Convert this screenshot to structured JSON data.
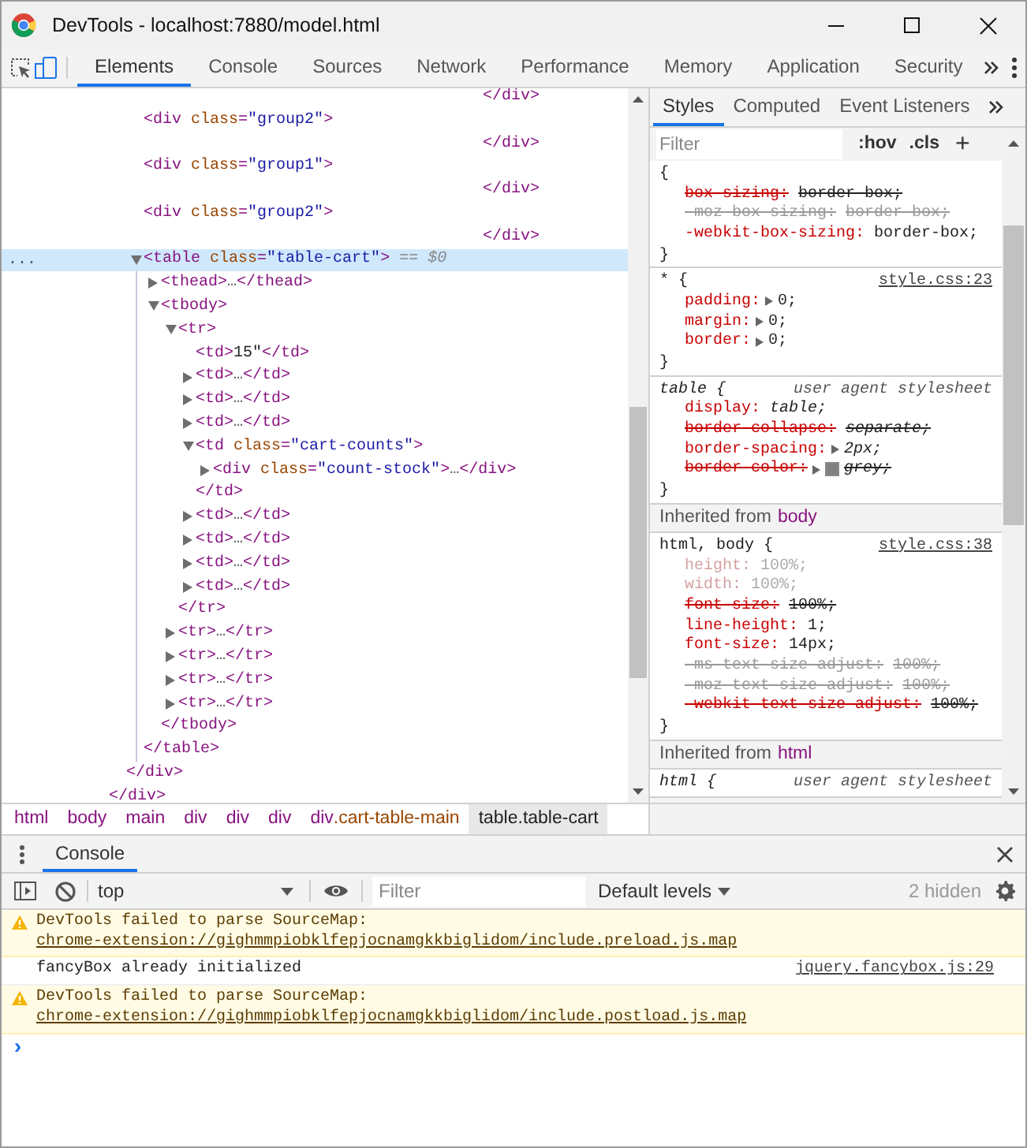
{
  "window": {
    "title": "DevTools - localhost:7880/model.html"
  },
  "tabs": [
    {
      "label": "Elements",
      "selected": true
    },
    {
      "label": "Console",
      "selected": false
    },
    {
      "label": "Sources",
      "selected": false
    },
    {
      "label": "Network",
      "selected": false
    },
    {
      "label": "Performance",
      "selected": false
    },
    {
      "label": "Memory",
      "selected": false
    },
    {
      "label": "Application",
      "selected": false
    },
    {
      "label": "Security",
      "selected": false
    }
  ],
  "elements": {
    "selection_marker": "...",
    "tree": [
      {
        "selected": false,
        "close": [
          {
            "kind": "tag",
            "text": "</div>"
          }
        ],
        "children": [
          {
            "selected": false,
            "close": [
              {
                "kind": "tag",
                "text": "</div>"
              }
            ],
            "children": [
              {
                "selected": false,
                "close_far": true,
                "close": [
                  {
                    "kind": "tag",
                    "text": "</div>"
                  }
                ]
              },
              {
                "selected": false,
                "open": [
                  {
                    "kind": "tag",
                    "text": "<div"
                  },
                  {
                    "kind": "attr",
                    "text": " class"
                  },
                  {
                    "kind": "tag",
                    "text": "="
                  },
                  {
                    "kind": "value",
                    "text": "\"group2\""
                  },
                  {
                    "kind": "tag",
                    "text": ">"
                  }
                ],
                "close_far": true,
                "close": [
                  {
                    "kind": "tag",
                    "text": "</div>"
                  }
                ]
              },
              {
                "selected": false,
                "open": [
                  {
                    "kind": "tag",
                    "text": "<div"
                  },
                  {
                    "kind": "attr",
                    "text": " class"
                  },
                  {
                    "kind": "tag",
                    "text": "="
                  },
                  {
                    "kind": "value",
                    "text": "\"group1\""
                  },
                  {
                    "kind": "tag",
                    "text": ">"
                  }
                ],
                "close_far": true,
                "close": [
                  {
                    "kind": "tag",
                    "text": "</div>"
                  }
                ]
              },
              {
                "selected": false,
                "open": [
                  {
                    "kind": "tag",
                    "text": "<div"
                  },
                  {
                    "kind": "attr",
                    "text": " class"
                  },
                  {
                    "kind": "tag",
                    "text": "="
                  },
                  {
                    "kind": "value",
                    "text": "\"group2\""
                  },
                  {
                    "kind": "tag",
                    "text": ">"
                  }
                ],
                "close_far": true,
                "close": [
                  {
                    "kind": "tag",
                    "text": "</div>"
                  }
                ]
              },
              {
                "selected": true,
                "expanded": true,
                "open": [
                  {
                    "kind": "tag",
                    "text": "<table"
                  },
                  {
                    "kind": "attr",
                    "text": " class"
                  },
                  {
                    "kind": "tag",
                    "text": "="
                  },
                  {
                    "kind": "value",
                    "text": "\"table-cart\""
                  },
                  {
                    "kind": "tag",
                    "text": ">"
                  },
                  {
                    "kind": "hint",
                    "text": " == $0"
                  }
                ],
                "close": [
                  {
                    "kind": "tag",
                    "text": "</table>"
                  }
                ],
                "children": [
                  {
                    "selected": false,
                    "expanded": false,
                    "open": [
                      {
                        "kind": "tag",
                        "text": "<thead>"
                      },
                      {
                        "kind": "ellipsis",
                        "text": "…"
                      },
                      {
                        "kind": "tag",
                        "text": "</thead>"
                      }
                    ]
                  },
                  {
                    "selected": false,
                    "expanded": true,
                    "open": [
                      {
                        "kind": "tag",
                        "text": "<tbody>"
                      }
                    ],
                    "close": [
                      {
                        "kind": "tag",
                        "text": "</tbody>"
                      }
                    ],
                    "children": [
                      {
                        "selected": false,
                        "expanded": true,
                        "open": [
                          {
                            "kind": "tag",
                            "text": "<tr>"
                          }
                        ],
                        "close": [
                          {
                            "kind": "tag",
                            "text": "</tr>"
                          }
                        ],
                        "children": [
                          {
                            "selected": false,
                            "open": [
                              {
                                "kind": "tag",
                                "text": "<td>"
                              },
                              {
                                "kind": "text",
                                "text": "15\""
                              },
                              {
                                "kind": "tag",
                                "text": "</td>"
                              }
                            ]
                          },
                          {
                            "selected": false,
                            "expanded": false,
                            "open": [
                              {
                                "kind": "tag",
                                "text": "<td>"
                              },
                              {
                                "kind": "ellipsis",
                                "text": "…"
                              },
                              {
                                "kind": "tag",
                                "text": "</td>"
                              }
                            ]
                          },
                          {
                            "selected": false,
                            "expanded": false,
                            "open": [
                              {
                                "kind": "tag",
                                "text": "<td>"
                              },
                              {
                                "kind": "ellipsis",
                                "text": "…"
                              },
                              {
                                "kind": "tag",
                                "text": "</td>"
                              }
                            ]
                          },
                          {
                            "selected": false,
                            "expanded": false,
                            "open": [
                              {
                                "kind": "tag",
                                "text": "<td>"
                              },
                              {
                                "kind": "ellipsis",
                                "text": "…"
                              },
                              {
                                "kind": "tag",
                                "text": "</td>"
                              }
                            ]
                          },
                          {
                            "selected": false,
                            "expanded": true,
                            "open": [
                              {
                                "kind": "tag",
                                "text": "<td"
                              },
                              {
                                "kind": "attr",
                                "text": " class"
                              },
                              {
                                "kind": "tag",
                                "text": "="
                              },
                              {
                                "kind": "value",
                                "text": "\"cart-counts\""
                              },
                              {
                                "kind": "tag",
                                "text": ">"
                              }
                            ],
                            "close": [
                              {
                                "kind": "tag",
                                "text": "</td>"
                              }
                            ],
                            "children": [
                              {
                                "selected": false,
                                "expanded": false,
                                "open": [
                                  {
                                    "kind": "tag",
                                    "text": "<div"
                                  },
                                  {
                                    "kind": "attr",
                                    "text": " class"
                                  },
                                  {
                                    "kind": "tag",
                                    "text": "="
                                  },
                                  {
                                    "kind": "value",
                                    "text": "\"count-stock\""
                                  },
                                  {
                                    "kind": "tag",
                                    "text": ">"
                                  },
                                  {
                                    "kind": "ellipsis",
                                    "text": "…"
                                  },
                                  {
                                    "kind": "tag",
                                    "text": "</div>"
                                  }
                                ]
                              }
                            ]
                          },
                          {
                            "selected": false,
                            "expanded": false,
                            "open": [
                              {
                                "kind": "tag",
                                "text": "<td>"
                              },
                              {
                                "kind": "ellipsis",
                                "text": "…"
                              },
                              {
                                "kind": "tag",
                                "text": "</td>"
                              }
                            ]
                          },
                          {
                            "selected": false,
                            "expanded": false,
                            "open": [
                              {
                                "kind": "tag",
                                "text": "<td>"
                              },
                              {
                                "kind": "ellipsis",
                                "text": "…"
                              },
                              {
                                "kind": "tag",
                                "text": "</td>"
                              }
                            ]
                          },
                          {
                            "selected": false,
                            "expanded": false,
                            "open": [
                              {
                                "kind": "tag",
                                "text": "<td>"
                              },
                              {
                                "kind": "ellipsis",
                                "text": "…"
                              },
                              {
                                "kind": "tag",
                                "text": "</td>"
                              }
                            ]
                          },
                          {
                            "selected": false,
                            "expanded": false,
                            "open": [
                              {
                                "kind": "tag",
                                "text": "<td>"
                              },
                              {
                                "kind": "ellipsis",
                                "text": "…"
                              },
                              {
                                "kind": "tag",
                                "text": "</td>"
                              }
                            ]
                          }
                        ]
                      },
                      {
                        "selected": false,
                        "expanded": false,
                        "open": [
                          {
                            "kind": "tag",
                            "text": "<tr>"
                          },
                          {
                            "kind": "ellipsis",
                            "text": "…"
                          },
                          {
                            "kind": "tag",
                            "text": "</tr>"
                          }
                        ]
                      },
                      {
                        "selected": false,
                        "expanded": false,
                        "open": [
                          {
                            "kind": "tag",
                            "text": "<tr>"
                          },
                          {
                            "kind": "ellipsis",
                            "text": "…"
                          },
                          {
                            "kind": "tag",
                            "text": "</tr>"
                          }
                        ]
                      },
                      {
                        "selected": false,
                        "expanded": false,
                        "open": [
                          {
                            "kind": "tag",
                            "text": "<tr>"
                          },
                          {
                            "kind": "ellipsis",
                            "text": "…"
                          },
                          {
                            "kind": "tag",
                            "text": "</tr>"
                          }
                        ]
                      },
                      {
                        "selected": false,
                        "expanded": false,
                        "open": [
                          {
                            "kind": "tag",
                            "text": "<tr>"
                          },
                          {
                            "kind": "ellipsis",
                            "text": "…"
                          },
                          {
                            "kind": "tag",
                            "text": "</tr>"
                          }
                        ]
                      }
                    ]
                  }
                ]
              }
            ]
          }
        ]
      }
    ]
  },
  "breadcrumbs": [
    {
      "tag": "html",
      "selected": false
    },
    {
      "tag": "body",
      "selected": false
    },
    {
      "tag": "main",
      "selected": false
    },
    {
      "tag": "div",
      "selected": false
    },
    {
      "tag": "div",
      "selected": false
    },
    {
      "tag": "div",
      "selected": false
    },
    {
      "tag": "div",
      "cls": ".cart-table-main",
      "selected": false
    },
    {
      "tag": "table",
      "cls": ".table-cart",
      "selected": true
    }
  ],
  "styles": {
    "tabs": [
      {
        "label": "Styles",
        "selected": true
      },
      {
        "label": "Computed",
        "selected": false
      },
      {
        "label": "Event Listeners",
        "selected": false
      }
    ],
    "filter": {
      "placeholder": "Filter"
    },
    "hov": ":hov",
    "cls": ".cls",
    "add": "+",
    "sections": [
      {
        "kind": "rule",
        "open": "{",
        "close": "}",
        "props": [
          {
            "name": "box-sizing:",
            "value": "border-box;",
            "kind": "overridden"
          },
          {
            "name": "-moz-box-sizing:",
            "value": "border-box;",
            "kind": "invalid"
          },
          {
            "name": "-webkit-box-sizing:",
            "value": "border-box;",
            "kind": "normal"
          }
        ]
      },
      {
        "kind": "rule",
        "open": "* {",
        "source": "style.css:23",
        "close": "}",
        "props": [
          {
            "name": "padding:",
            "value": "0;",
            "kind": "normal",
            "expandable": true
          },
          {
            "name": "margin:",
            "value": "0;",
            "kind": "normal",
            "expandable": true
          },
          {
            "name": "border:",
            "value": "0;",
            "kind": "normal",
            "expandable": true
          }
        ]
      },
      {
        "kind": "rule",
        "user_agent": true,
        "open": "table {",
        "origin": "user agent stylesheet",
        "close": "}",
        "props": [
          {
            "name": "display:",
            "value": "table;",
            "kind": "normal"
          },
          {
            "name": "border-collapse:",
            "value": "separate;",
            "kind": "overridden"
          },
          {
            "name": "border-spacing:",
            "value": "2px;",
            "kind": "normal",
            "expandable": true
          },
          {
            "name": "border-color:",
            "value": "grey;",
            "kind": "overridden",
            "expandable": true,
            "color": "#808080"
          }
        ]
      },
      {
        "kind": "inherited",
        "label": "Inherited from",
        "tag": "body"
      },
      {
        "kind": "rule",
        "open": "html, body {",
        "source": "style.css:38",
        "close": "}",
        "props": [
          {
            "name": "height:",
            "value": "100%;",
            "kind": "inactive"
          },
          {
            "name": "width:",
            "value": "100%;",
            "kind": "inactive"
          },
          {
            "name": "font-size:",
            "value": "100%;",
            "kind": "overridden"
          },
          {
            "name": "line-height:",
            "value": "1;",
            "kind": "normal"
          },
          {
            "name": "font-size:",
            "value": "14px;",
            "kind": "normal"
          },
          {
            "name": "-ms-text-size-adjust:",
            "value": "100%;",
            "kind": "invalid"
          },
          {
            "name": "-moz-text-size-adjust:",
            "value": "100%;",
            "kind": "invalid"
          },
          {
            "name": "-webkit-text-size-adjust:",
            "value": "100%;",
            "kind": "overridden"
          }
        ]
      },
      {
        "kind": "inherited",
        "label": "Inherited from",
        "tag": "html"
      },
      {
        "kind": "rule",
        "user_agent": true,
        "open": "html {",
        "origin": "user agent stylesheet"
      }
    ]
  },
  "drawer": {
    "tabs": [
      {
        "label": "Console",
        "selected": true
      }
    ],
    "context": "top",
    "filter": {
      "placeholder": "Filter"
    },
    "levels": "Default levels",
    "hidden": "2 hidden",
    "messages": [
      {
        "kind": "warning",
        "text": "DevTools failed to parse SourceMap: ",
        "link": "chrome-extension://gighmmpiobklfepjocnamgkkbiglidom/include.preload.js.map"
      },
      {
        "kind": "log",
        "text": "fancyBox already initialized",
        "source": "jquery.fancybox.js:29"
      },
      {
        "kind": "warning",
        "text": "DevTools failed to parse SourceMap: ",
        "link": "chrome-extension://gighmmpiobklfepjocnamgkkbiglidom/include.postload.js.map"
      }
    ],
    "prompt": "›"
  }
}
